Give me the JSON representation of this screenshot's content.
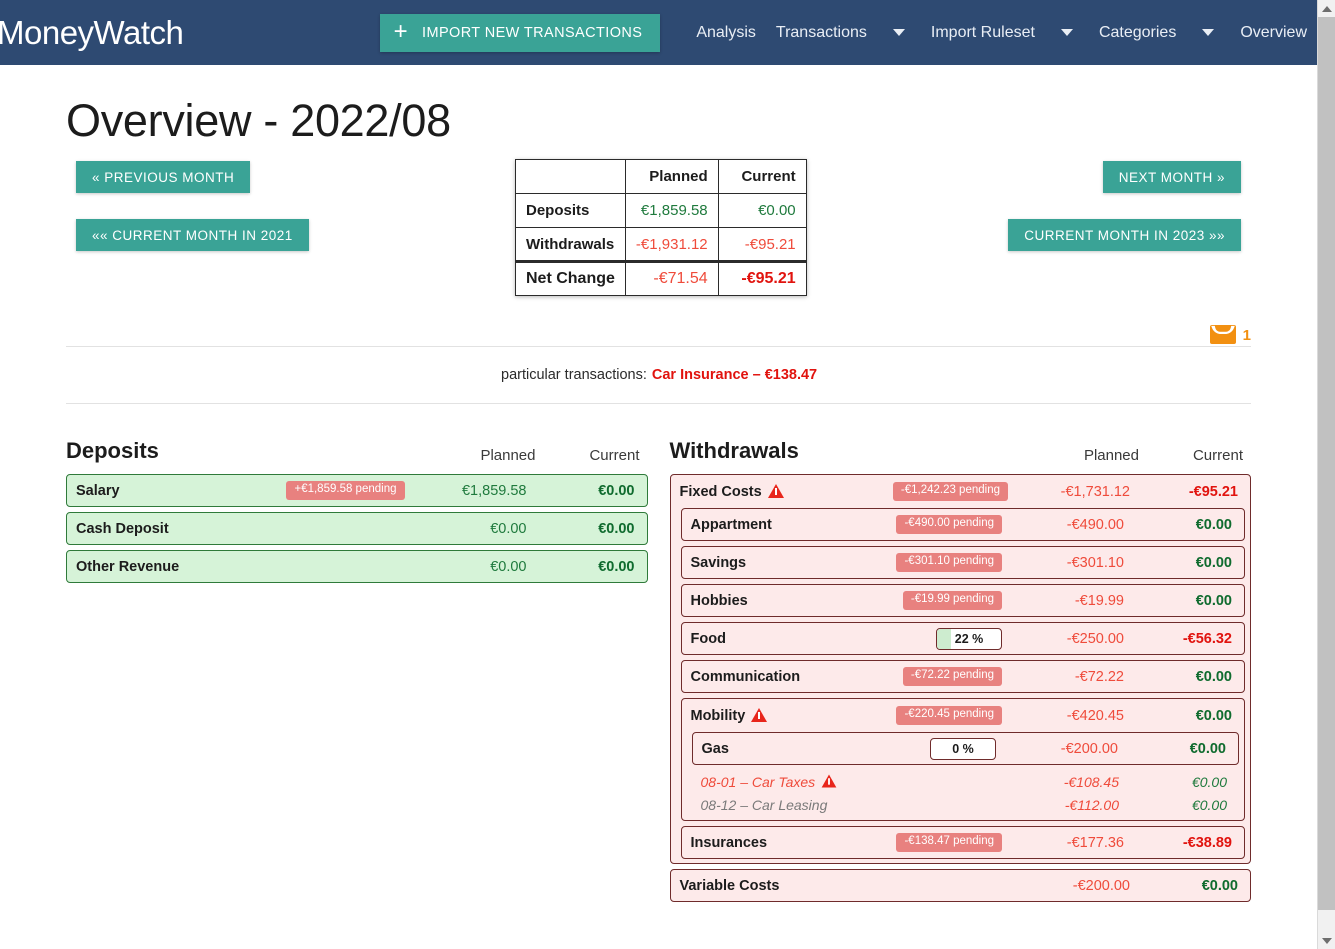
{
  "navbar": {
    "brand": "MoneyWatch",
    "import_button": "IMPORT NEW TRANSACTIONS",
    "links": [
      {
        "label": "Analysis",
        "caret": false
      },
      {
        "label": "Transactions",
        "caret": true
      },
      {
        "label": "Import Ruleset",
        "caret": true
      },
      {
        "label": "Categories",
        "caret": true
      },
      {
        "label": "Overview",
        "caret": false
      }
    ],
    "bg_color": "#2e4a72",
    "accent_color": "#3aa396"
  },
  "page": {
    "title": "Overview - 2022/08",
    "prev_month": "« PREVIOUS MONTH",
    "prev_year": "«« CURRENT MONTH IN 2021",
    "next_month": "NEXT MONTH »",
    "next_year": "CURRENT MONTH IN 2023 »»"
  },
  "summary": {
    "col_planned": "Planned",
    "col_current": "Current",
    "rows": [
      {
        "label": "Deposits",
        "planned": "€1,859.58",
        "current": "€0.00"
      },
      {
        "label": "Withdrawals",
        "planned": "-€1,931.12",
        "current": "-€95.21"
      },
      {
        "label": "Net Change",
        "planned": "-€71.54",
        "current": "-€95.21"
      }
    ]
  },
  "mail": {
    "count": "1",
    "icon": "envelope-icon"
  },
  "particular": {
    "label": "particular transactions:",
    "value": "Car Insurance – €138.47"
  },
  "deposits": {
    "title": "Deposits",
    "col_planned": "Planned",
    "col_current": "Current",
    "rows": [
      {
        "name": "Salary",
        "badge": "+€1,859.58 pending",
        "planned": "€1,859.58",
        "current": "€0.00"
      },
      {
        "name": "Cash Deposit",
        "badge": "",
        "planned": "€0.00",
        "current": "€0.00"
      },
      {
        "name": "Other Revenue",
        "badge": "",
        "planned": "€0.00",
        "current": "€0.00"
      }
    ]
  },
  "withdrawals": {
    "title": "Withdrawals",
    "col_planned": "Planned",
    "col_current": "Current",
    "fixed_costs": {
      "name": "Fixed Costs",
      "badge": "-€1,242.23 pending",
      "planned": "-€1,731.12",
      "current": "-€95.21",
      "warning": true
    },
    "children": [
      {
        "name": "Appartment",
        "badge": "-€490.00 pending",
        "planned": "-€490.00",
        "current": "€0.00"
      },
      {
        "name": "Savings",
        "badge": "-€301.10 pending",
        "planned": "-€301.10",
        "current": "€0.00"
      },
      {
        "name": "Hobbies",
        "badge": "-€19.99 pending",
        "planned": "-€19.99",
        "current": "€0.00"
      },
      {
        "name": "Food",
        "percent": "22 %",
        "percent_value": 22,
        "planned": "-€250.00",
        "current": "-€56.32",
        "current_negative": true
      },
      {
        "name": "Communication",
        "badge": "-€72.22 pending",
        "planned": "-€72.22",
        "current": "€0.00"
      }
    ],
    "mobility": {
      "name": "Mobility",
      "badge": "-€220.45 pending",
      "planned": "-€420.45",
      "current": "€0.00",
      "warning": true,
      "gas": {
        "name": "Gas",
        "percent": "0 %",
        "percent_value": 0,
        "planned": "-€200.00",
        "current": "€0.00"
      },
      "transactions": [
        {
          "name": "08-01 – Car Taxes",
          "warning": true,
          "planned": "-€108.45",
          "current": "€0.00",
          "style": "t-red"
        },
        {
          "name": "08-12 – Car Leasing",
          "warning": false,
          "planned": "-€112.00",
          "current": "€0.00",
          "style": "t-gray"
        }
      ]
    },
    "insurances": {
      "name": "Insurances",
      "badge": "-€138.47 pending",
      "planned": "-€177.36",
      "current": "-€38.89",
      "current_negative": true
    },
    "variable_costs": {
      "name": "Variable Costs",
      "planned": "-€200.00",
      "current": "€0.00"
    }
  },
  "colors": {
    "positive": "#1f7a3d",
    "negative": "#ef4b3b",
    "negative_strong": "#e1130e",
    "badge": "#e8817f",
    "deposit_row": "#d6f3d8",
    "withdrawal_row": "#fdeaea",
    "mail": "#f29011"
  }
}
